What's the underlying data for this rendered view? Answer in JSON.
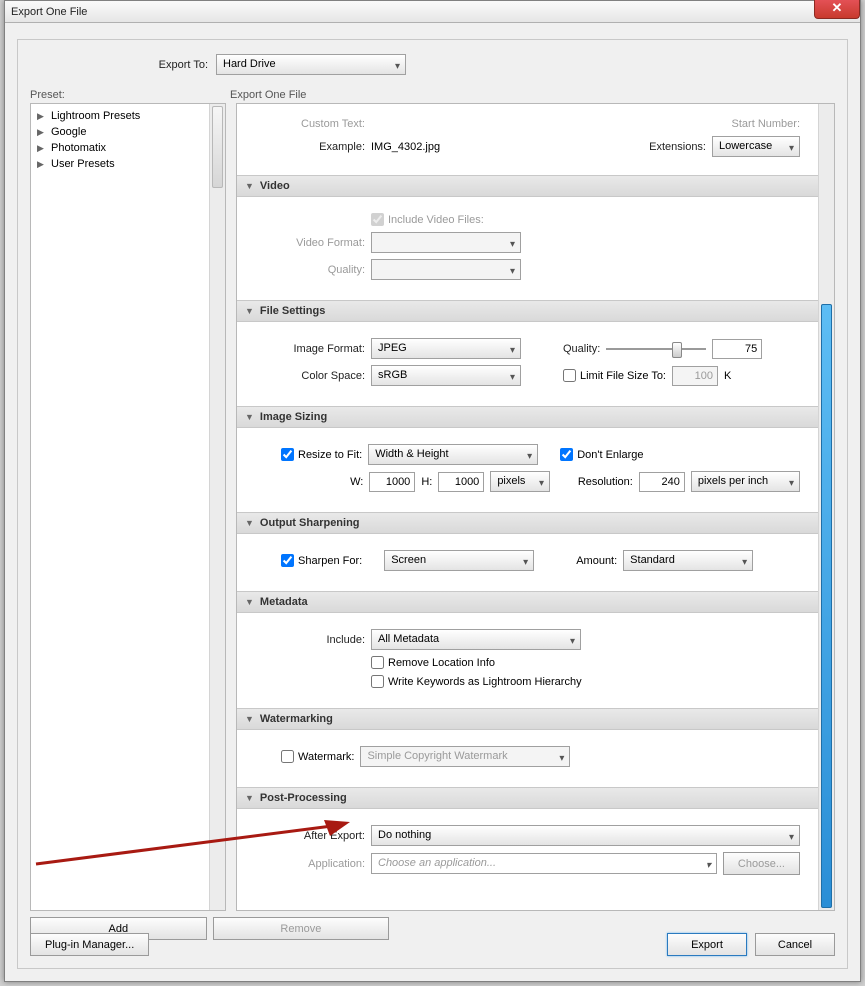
{
  "window": {
    "title": "Export One File"
  },
  "exportTo": {
    "label": "Export To:",
    "value": "Hard Drive"
  },
  "preset": {
    "header": "Preset:",
    "items": [
      "Lightroom Presets",
      "Google",
      "Photomatix",
      "User Presets"
    ],
    "addLabel": "Add",
    "removeLabel": "Remove"
  },
  "settingsHeader": "Export One File",
  "top": {
    "customTextLabel": "Custom Text:",
    "startNumberLabel": "Start Number:",
    "exampleLabel": "Example:",
    "exampleValue": "IMG_4302.jpg",
    "extensionsLabel": "Extensions:",
    "extensionsValue": "Lowercase"
  },
  "video": {
    "title": "Video",
    "includeLabel": "Include Video Files:",
    "formatLabel": "Video Format:",
    "qualityLabel": "Quality:"
  },
  "fileSettings": {
    "title": "File Settings",
    "imageFormatLabel": "Image Format:",
    "imageFormatValue": "JPEG",
    "qualityLabel": "Quality:",
    "qualityValue": "75",
    "colorSpaceLabel": "Color Space:",
    "colorSpaceValue": "sRGB",
    "limitLabel": "Limit File Size To:",
    "limitValue": "100",
    "limitUnit": "K"
  },
  "imageSizing": {
    "title": "Image Sizing",
    "resizeLabel": "Resize to Fit:",
    "resizeValue": "Width & Height",
    "dontEnlargeLabel": "Don't Enlarge",
    "wLabel": "W:",
    "wValue": "1000",
    "hLabel": "H:",
    "hValue": "1000",
    "unitValue": "pixels",
    "resolutionLabel": "Resolution:",
    "resolutionValue": "240",
    "resUnitValue": "pixels per inch"
  },
  "sharpen": {
    "title": "Output Sharpening",
    "sharpenForLabel": "Sharpen For:",
    "sharpenForValue": "Screen",
    "amountLabel": "Amount:",
    "amountValue": "Standard"
  },
  "metadata": {
    "title": "Metadata",
    "includeLabel": "Include:",
    "includeValue": "All Metadata",
    "removeLocLabel": "Remove Location Info",
    "writeKwLabel": "Write Keywords as Lightroom Hierarchy"
  },
  "watermark": {
    "title": "Watermarking",
    "watermarkLabel": "Watermark:",
    "presetValue": "Simple Copyright Watermark"
  },
  "post": {
    "title": "Post-Processing",
    "afterLabel": "After Export:",
    "afterValue": "Do nothing",
    "appLabel": "Application:",
    "appPlaceholder": "Choose an application...",
    "chooseLabel": "Choose..."
  },
  "footer": {
    "pluginLabel": "Plug-in Manager...",
    "exportLabel": "Export",
    "cancelLabel": "Cancel"
  }
}
